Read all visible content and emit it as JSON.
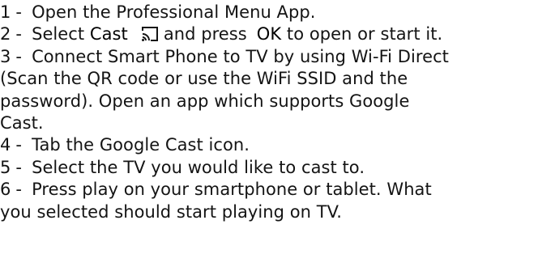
{
  "steps": [
    {
      "number": "1",
      "sep": "-",
      "lines": [
        "Open the Professional Menu App."
      ]
    },
    {
      "number": "2",
      "sep": "-",
      "pre": "Select",
      "cast_word": "Cast",
      "cast_icon": "cast-icon",
      "mid": "and press",
      "ok_word": "OK",
      "post": "to open or start it."
    },
    {
      "number": "3",
      "sep": "-",
      "lines": [
        "Connect Smart Phone to TV by using Wi-Fi Direct",
        "(Scan the QR code or use the WiFi SSID and the",
        "password). Open an app which supports Google",
        "Cast."
      ]
    },
    {
      "number": "4",
      "sep": "-",
      "lines": [
        "Tab the Google Cast icon."
      ]
    },
    {
      "number": "5",
      "sep": "-",
      "lines": [
        "Select the TV you would like to cast to."
      ]
    },
    {
      "number": "6",
      "sep": "-",
      "lines": [
        "Press play on your smartphone or tablet. What",
        "you selected should start playing on TV."
      ]
    }
  ]
}
